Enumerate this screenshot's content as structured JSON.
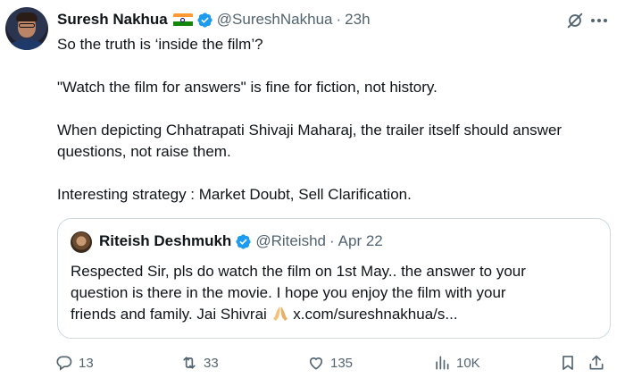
{
  "post": {
    "author_name": "Suresh Nakhua",
    "handle": "@SureshNakhua",
    "separator": "·",
    "time": "23h",
    "lines": [
      "So the truth is ‘inside the film’?",
      "",
      "\"Watch the film for answers\" is fine for fiction, not history.",
      "",
      "When depicting Chhatrapati Shivaji Maharaj, the trailer itself should answer",
      "questions, not raise them.",
      "",
      "Interesting strategy : Market Doubt, Sell Clarification."
    ]
  },
  "quote": {
    "author_name": "Riteish Deshmukh",
    "handle": "@Riteishd",
    "separator": "·",
    "time": "Apr 22",
    "line1": "Respected Sir, pls do watch the film on 1st May.. the answer to your",
    "line2": "question is there in the movie. I hope you enjoy the film with your",
    "line3_before": "friends and family.  Jai Shivrai ",
    "line3_after": " x.com/sureshnakhua/s..."
  },
  "actions": {
    "replies": "13",
    "reposts": "33",
    "likes": "135",
    "views": "10K"
  },
  "icons": {
    "verified": "verified-badge-icon",
    "flag": "india-flag-icon",
    "grok": "grok-icon",
    "more": "more-icon",
    "reply": "reply-icon",
    "repost": "repost-icon",
    "like": "heart-icon",
    "views": "views-icon",
    "bookmark": "bookmark-icon",
    "share": "share-icon",
    "pray": "folded-hands-emoji"
  },
  "colors": {
    "verified": "#1d9bf0",
    "secondary_text": "#536471",
    "border": "#cfd9de"
  }
}
